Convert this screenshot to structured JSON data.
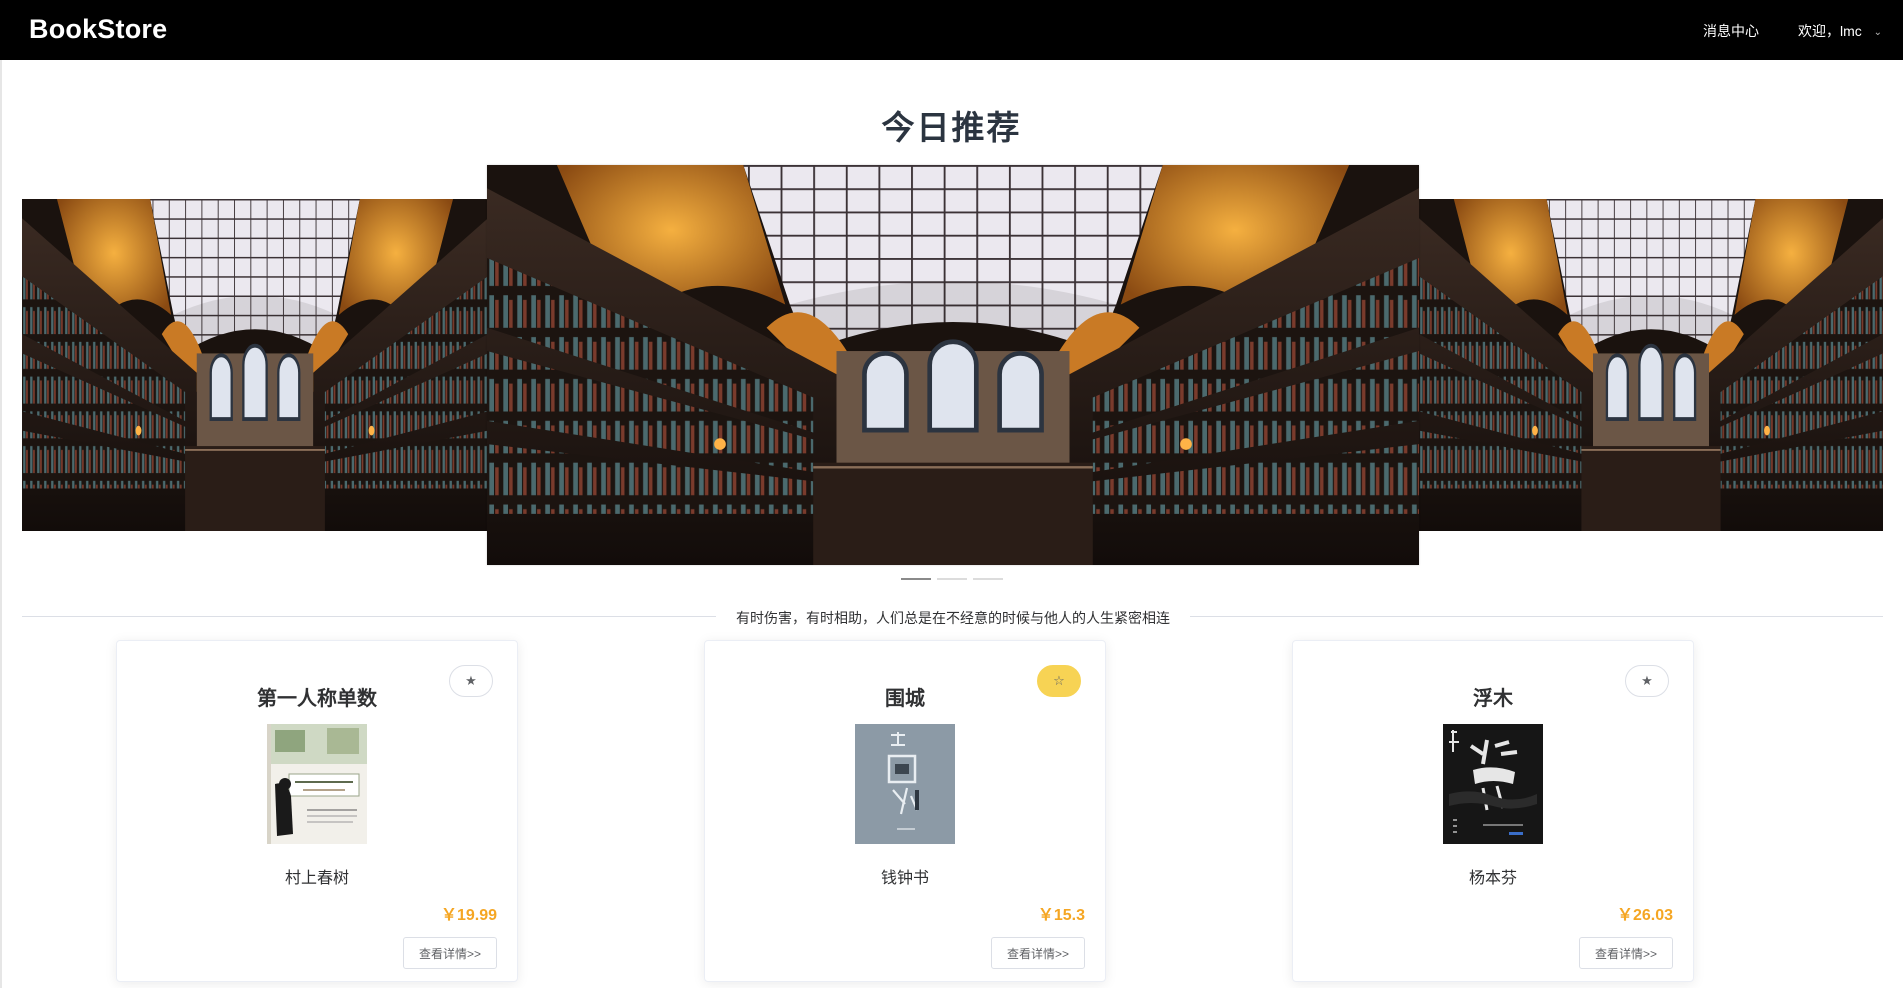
{
  "header": {
    "brand": "BookStore",
    "nav_messages": "消息中心",
    "nav_user": "欢迎，lmc",
    "user_menu_icon": "chevron-down-icon"
  },
  "recommend": {
    "title": "今日推荐",
    "carousel": {
      "slides": [
        "library-hall-image",
        "library-hall-image",
        "library-hall-image"
      ],
      "indicator_count": 3,
      "active_index": 0
    }
  },
  "quote": "有时伤害，有时相助，人们总是在不经意的时候与他人的人生紧密相连",
  "books": [
    {
      "title": "第一人称单数",
      "author": "村上春树",
      "price": "￥19.99",
      "favorite_icon": "★",
      "favorited": false,
      "detail_label": "查看详情>>",
      "cover": {
        "bg": "#f2f0ea",
        "text": "第一人称单数",
        "subtext": "村上春树"
      }
    },
    {
      "title": "围城",
      "author": "钱钟书",
      "price": "￥15.3",
      "favorite_icon": "☆",
      "favorited": true,
      "detail_label": "查看详情>>",
      "cover": {
        "bg": "#8c9aa6",
        "text": "围城",
        "subtext": "钱钟书"
      }
    },
    {
      "title": "浮木",
      "author": "杨本芬",
      "price": "￥26.03",
      "favorite_icon": "★",
      "favorited": false,
      "detail_label": "查看详情>>",
      "cover": {
        "bg": "#1a1a1a",
        "text": "浮木",
        "subtext": "杨本芬"
      }
    }
  ],
  "colors": {
    "header_bg": "#000000",
    "price": "#f5a623",
    "favorite_active": "#f7d354"
  }
}
